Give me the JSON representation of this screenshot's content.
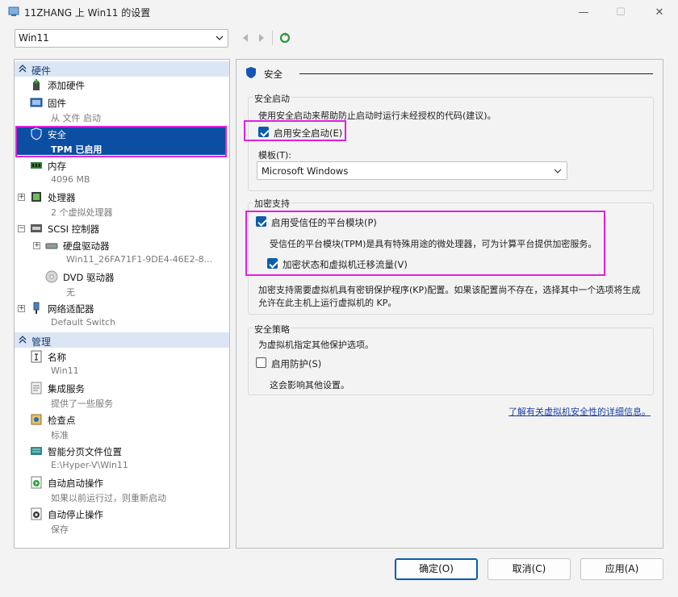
{
  "window": {
    "title": "11ZHANG 上 Win11 的设置"
  },
  "toolbar": {
    "vm_selected": "Win11"
  },
  "tree": {
    "hardware_label": "硬件",
    "management_label": "管理",
    "items": {
      "add_hardware": {
        "name": "添加硬件"
      },
      "firmware": {
        "name": "固件",
        "sub": "从 文件 启动"
      },
      "security": {
        "name": "安全",
        "sub": "TPM 已启用"
      },
      "memory": {
        "name": "内存",
        "sub": "4096 MB"
      },
      "processor": {
        "name": "处理器",
        "sub": "2 个虚拟处理器"
      },
      "scsi": {
        "name": "SCSI 控制器"
      },
      "hard_drive": {
        "name": "硬盘驱动器",
        "sub": "Win11_26FA71F1-9DE4-46E2-8..."
      },
      "dvd": {
        "name": "DVD 驱动器",
        "sub": "无"
      },
      "network": {
        "name": "网络适配器",
        "sub": "Default Switch"
      },
      "name": {
        "name": "名称",
        "sub": "Win11"
      },
      "integration": {
        "name": "集成服务",
        "sub": "提供了一些服务"
      },
      "checkpoints": {
        "name": "检查点",
        "sub": "标准"
      },
      "paging": {
        "name": "智能分页文件位置",
        "sub": "E:\\Hyper-V\\Win11"
      },
      "auto_start": {
        "name": "自动启动操作",
        "sub": "如果以前运行过，则重新启动"
      },
      "auto_stop": {
        "name": "自动停止操作",
        "sub": "保存"
      }
    }
  },
  "security": {
    "title": "安全",
    "secure_boot": {
      "group_title": "安全启动",
      "desc": "使用安全启动来帮助防止启动时运行未经授权的代码(建议)。",
      "enable_label": "启用安全启动(E)",
      "enabled": true,
      "template_label": "模板(T):",
      "template_value": "Microsoft Windows"
    },
    "encryption": {
      "group_title": "加密支持",
      "tpm_label": "启用受信任的平台模块(P)",
      "tpm_enabled": true,
      "tpm_desc": "受信任的平台模块(TPM)是具有特殊用途的微处理器，可为计算平台提供加密服务。",
      "encrypt_label": "加密状态和虚拟机迁移流量(V)",
      "encrypt_enabled": true,
      "note_line1": "加密支持需要虚拟机具有密钥保护程序(KP)配置。如果该配置尚不存在，选择其中一个选项将生成",
      "note_line2": "允许在此主机上运行虚拟机的 KP。"
    },
    "policy": {
      "group_title": "安全策略",
      "desc": "为虚拟机指定其他保护选项。",
      "shielding_label": "启用防护(S)",
      "shielding_enabled": false,
      "shielding_note": "这会影响其他设置。"
    },
    "learn_more": "了解有关虚拟机安全性的详细信息。"
  },
  "buttons": {
    "ok": "确定(O)",
    "cancel": "取消(C)",
    "apply": "应用(A)"
  },
  "colors": {
    "accent": "#0b5cad",
    "selection": "#0b4ea2",
    "highlight": "#e020e0",
    "category_bg": "#dbe6f4"
  }
}
